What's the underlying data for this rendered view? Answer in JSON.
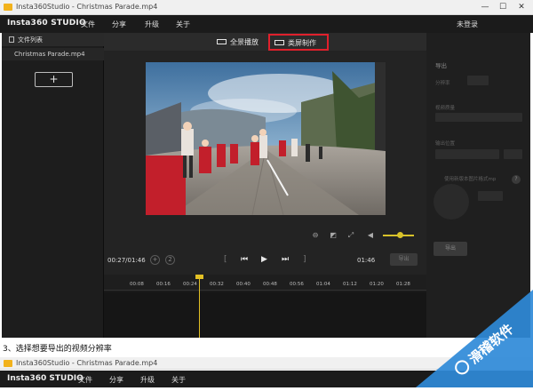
{
  "window": {
    "title": "Insta360Studio - Christmas Parade.mp4",
    "controls": {
      "minimize": "—",
      "maximize": "☐",
      "close": "✕"
    }
  },
  "menubar": {
    "brand": "Insta360 STUDIO",
    "items": [
      "文件",
      "分享",
      "升级",
      "关于"
    ],
    "login": "未登录"
  },
  "sidebar": {
    "header": "文件列表",
    "files": [
      "Christmas Parade.mp4"
    ],
    "add_label": "+"
  },
  "modes": {
    "full": "全景播放",
    "pan": "类屏制作"
  },
  "player": {
    "current_time": "00:27/01:46",
    "end_time": "01:46",
    "marker_label": "2",
    "export_button": "导出",
    "volume_level": 0.55
  },
  "timeline": {
    "ticks": [
      "00:08",
      "00:16",
      "00:24",
      "00:32",
      "00:40",
      "00:48",
      "00:56",
      "01:04",
      "01:12",
      "01:20",
      "01:28"
    ]
  },
  "right_panel": {
    "title": "导出",
    "labels": [
      "分辨率",
      "视频质量",
      "输出位置",
      "使用新版本图片格式mp"
    ],
    "help": "?",
    "export_button": "导出"
  },
  "caption": "3、选择想要导出的视频分辨率",
  "second_window": {
    "title": "Insta360Studio - Christmas Parade.mp4",
    "brand": "Insta360 STUDIO",
    "items": [
      "文件",
      "分享",
      "升级",
      "关于"
    ]
  },
  "watermark": {
    "text": "滑稽软件"
  },
  "colors": {
    "accent_yellow": "#e2c025",
    "highlight_red": "#e0202c",
    "watermark_blue": "#2f8ad8"
  }
}
